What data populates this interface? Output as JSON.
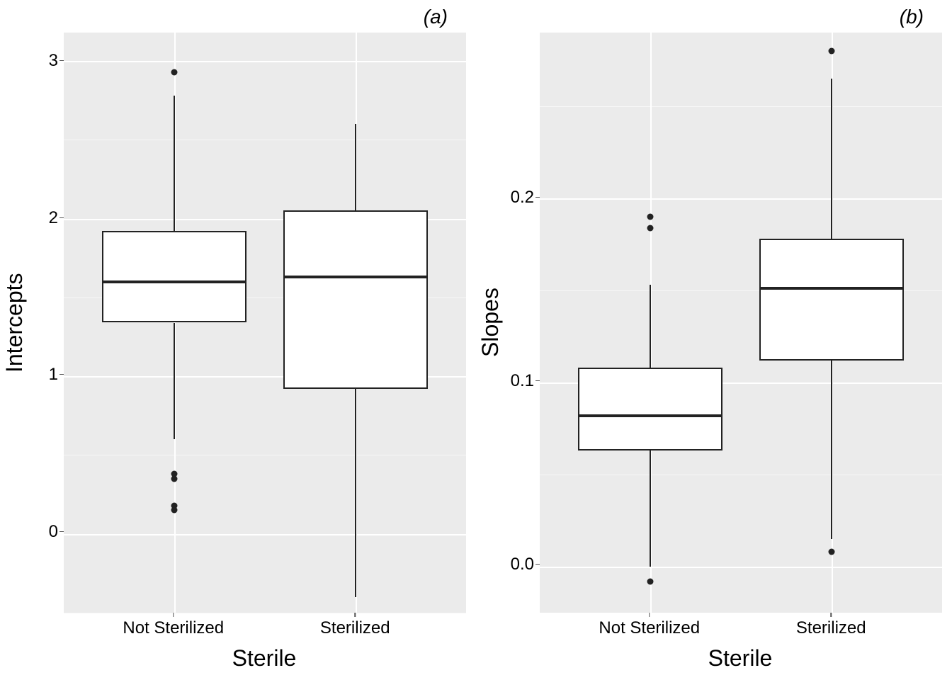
{
  "chart_data": [
    {
      "type": "boxplot",
      "title": "(a)",
      "xlabel": "Sterile",
      "ylabel": "Intercepts",
      "ylim": [
        -0.5,
        3.18
      ],
      "yticks": [
        0,
        1,
        2,
        3
      ],
      "yminor": [
        -0.5,
        0.5,
        1.5,
        2.5
      ],
      "categories": [
        "Not Sterilized",
        "Sterilized"
      ],
      "boxes": [
        {
          "category": "Not Sterilized",
          "min": 0.6,
          "q1": 1.34,
          "median": 1.6,
          "q3": 1.92,
          "max": 2.78,
          "outliers": [
            0.15,
            0.18,
            0.35,
            0.38,
            2.93
          ]
        },
        {
          "category": "Sterilized",
          "min": -0.4,
          "q1": 0.92,
          "median": 1.63,
          "q3": 2.05,
          "max": 2.6,
          "outliers": []
        }
      ]
    },
    {
      "type": "boxplot",
      "title": "(b)",
      "xlabel": "Sterile",
      "ylabel": "Slopes",
      "ylim": [
        -0.025,
        0.29
      ],
      "yticks": [
        0.0,
        0.1,
        0.2
      ],
      "yminor": [
        0.05,
        0.15,
        0.25
      ],
      "categories": [
        "Not Sterilized",
        "Sterilized"
      ],
      "boxes": [
        {
          "category": "Not Sterilized",
          "min": 0.0,
          "q1": 0.063,
          "median": 0.082,
          "q3": 0.108,
          "max": 0.153,
          "outliers": [
            -0.008,
            0.184,
            0.19
          ]
        },
        {
          "category": "Sterilized",
          "min": 0.015,
          "q1": 0.112,
          "median": 0.151,
          "q3": 0.178,
          "max": 0.265,
          "outliers": [
            0.008,
            0.28
          ]
        }
      ]
    }
  ]
}
